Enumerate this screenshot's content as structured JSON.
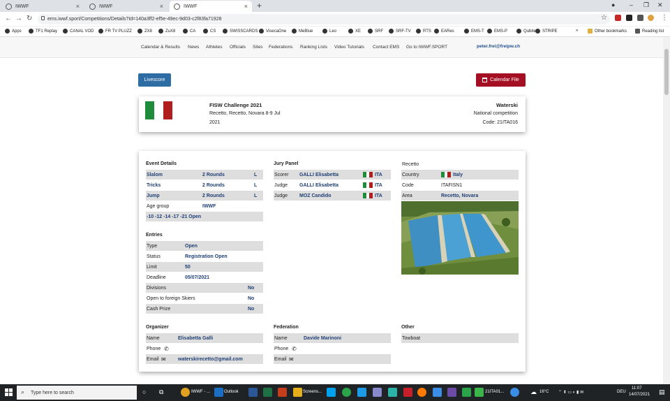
{
  "browser": {
    "tabs": [
      {
        "label": "IWWF",
        "active": false
      },
      {
        "label": "IWWF",
        "active": false
      },
      {
        "label": "IWWF",
        "active": true
      }
    ],
    "url": "ems.iwwf.sport/Competitions/Details?Id=140a3ff2-ef5e-49ec-9d03-c2f83fa71928",
    "bookmarks": [
      "Apps",
      "TF1 Replay",
      "CANAL VOD",
      "FR TV PLUZZ",
      "ZX8",
      "ZuX8",
      "CA",
      "CS",
      "SWISSCARDS",
      "VisecaOne",
      "MeBlue",
      "Leo",
      "XE",
      "SRF",
      "SRF-TV",
      "RTS",
      "EARes",
      "EMS-T",
      "EMS-P",
      "Qubiteq",
      "STRIPE"
    ],
    "bookmarks_right": [
      "Other bookmarks",
      "Reading list"
    ]
  },
  "nav": {
    "items": [
      "Calendar & Results",
      "News",
      "Athletes",
      "Officials",
      "Sites",
      "Federations",
      "Ranking Lists",
      "Video Tutorials",
      "Contact EMS",
      "Go to IWWF.SPORT"
    ],
    "user": "peter.frei@freipw.ch"
  },
  "buttons": {
    "livescore": "Livescore",
    "calendar_file": "Calendar File"
  },
  "competition": {
    "name": "FISW Challenge 2021",
    "location_dates": "Recetto, Recetto, Novara 8-9 Jul",
    "year": "2021",
    "sport": "Waterski",
    "type": "National competition",
    "code": "Code: 21ITA016",
    "flag_colors": [
      "#1e8c3a",
      "#ffffff",
      "#b01e1e"
    ]
  },
  "event_details": {
    "title": "Event Details",
    "events": [
      {
        "name": "Slalom",
        "rounds": "2 Rounds",
        "flag": "L"
      },
      {
        "name": "Tricks",
        "rounds": "2 Rounds",
        "flag": "L"
      },
      {
        "name": "Jump",
        "rounds": "2 Rounds",
        "flag": "L"
      }
    ],
    "age_group_label": "Age group",
    "age_group_value": "IWWF",
    "age_groups": "-10 -12 -14 -17 -21 Open"
  },
  "entries": {
    "title": "Entries",
    "rows": [
      {
        "label": "Type",
        "value": "Open"
      },
      {
        "label": "Status",
        "value": "Registration Open"
      },
      {
        "label": "Limit",
        "value": "50"
      },
      {
        "label": "Deadline",
        "value": "05/07/2021"
      },
      {
        "label": "Divisions",
        "value": "No"
      },
      {
        "label": "Open to foreign Skiers",
        "value": "No"
      },
      {
        "label": "Cash Prize",
        "value": "No"
      }
    ]
  },
  "jury": {
    "title": "Jury Panel",
    "rows": [
      {
        "role": "Scorer",
        "name": "GALLI Elisabetta",
        "nation": "ITA"
      },
      {
        "role": "Judge",
        "name": "GALLI Elisabetta",
        "nation": "ITA"
      },
      {
        "role": "Judge",
        "name": "MOZ Candido",
        "nation": "ITA"
      }
    ]
  },
  "site": {
    "title": "Recetto",
    "rows": [
      {
        "label": "Country",
        "value": "Italy"
      },
      {
        "label": "Code",
        "value": "ITAFISN1"
      },
      {
        "label": "Area",
        "value": "Recetto, Novara"
      }
    ]
  },
  "organizer": {
    "title": "Organizer",
    "name_label": "Name",
    "name": "Elisabetta Galli",
    "phone_label": "Phone",
    "email_label": "Email",
    "email": "waterskirecetto@gmail.com"
  },
  "federation": {
    "title": "Federation",
    "name_label": "Name",
    "name": "Davide Marinoni",
    "phone_label": "Phone",
    "email_label": "Email"
  },
  "other": {
    "title": "Other",
    "towboat_label": "Towboat"
  },
  "taskbar": {
    "search_placeholder": "Type here to search",
    "apps": [
      "IWWF - ...",
      "Outlook",
      "Screens...",
      "21ITA01..."
    ],
    "weather": "16°C",
    "lang": "DEU",
    "time": "11:07",
    "date": "14/07/2021"
  }
}
